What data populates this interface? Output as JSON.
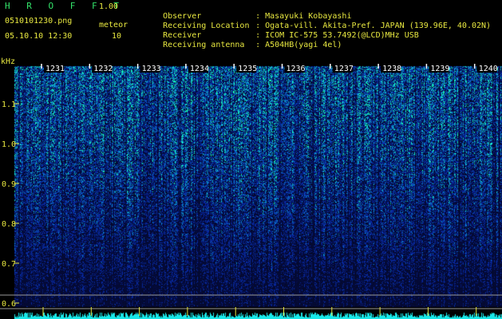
{
  "app": {
    "title": "H R O F F T",
    "version": "1.00",
    "file_name": "0510101230.png",
    "timestamp": "05.10.10 12:30",
    "mode_label": "meteor",
    "mode_value": "10"
  },
  "info": [
    {
      "label": "Observer",
      "value": "Masayuki Kobayashi"
    },
    {
      "label": "Receiving Location",
      "value": "Ogata-vill. Akita-Pref. JAPAN (139.96E, 40.02N)"
    },
    {
      "label": "Receiver",
      "value": "ICOM IC-575 53.7492(@LCD)MHz USB"
    },
    {
      "label": "Receiving antenna",
      "value": "A504HB(yagi 4el)"
    }
  ],
  "info_separator": ":",
  "axis": {
    "unit": "kHz",
    "y_ticks": [
      "1.1",
      "1.0",
      "0.9",
      "0.8",
      "0.7",
      "0.6"
    ],
    "time_ticks": [
      "1231",
      "1232",
      "1233",
      "1234",
      "1235",
      "1236",
      "1237",
      "1238",
      "1239",
      "1240"
    ]
  },
  "colors": {
    "title": "#33e36a",
    "text": "#e8e840",
    "spectrum_low": "#08124a",
    "spectrum_high": "#3cff9a",
    "baseline": "#19e8e8"
  }
}
